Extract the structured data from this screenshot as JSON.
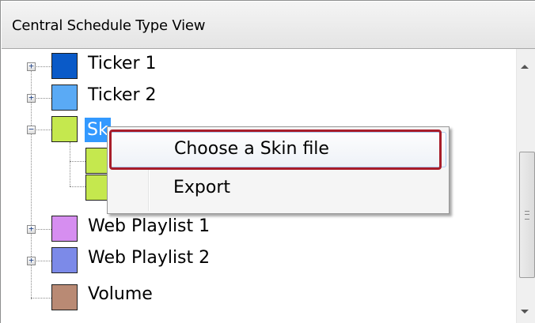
{
  "panel": {
    "title": "Central Schedule Type View"
  },
  "tree": {
    "items": [
      {
        "label": "Ticker 1",
        "color": "#0a5ac8",
        "expander": "+"
      },
      {
        "label": "Ticker 2",
        "color": "#5aaaf5",
        "expander": "+"
      },
      {
        "label": "Skin",
        "color": "#c5e84e",
        "expander": "−",
        "selected": true
      },
      {
        "label": "",
        "color": "#c5e84e"
      },
      {
        "label": "",
        "color": "#c5e84e"
      },
      {
        "label": "Web Playlist 1",
        "color": "#d68ef0",
        "expander": "+"
      },
      {
        "label": "Web Playlist 2",
        "color": "#7c8ae8",
        "expander": "+"
      },
      {
        "label": "Volume",
        "color": "#b98a74"
      }
    ],
    "selected_label_visible": "Sk"
  },
  "context_menu": {
    "items": [
      {
        "label": "Choose a Skin file",
        "highlighted": true
      },
      {
        "label": "Export"
      }
    ]
  }
}
